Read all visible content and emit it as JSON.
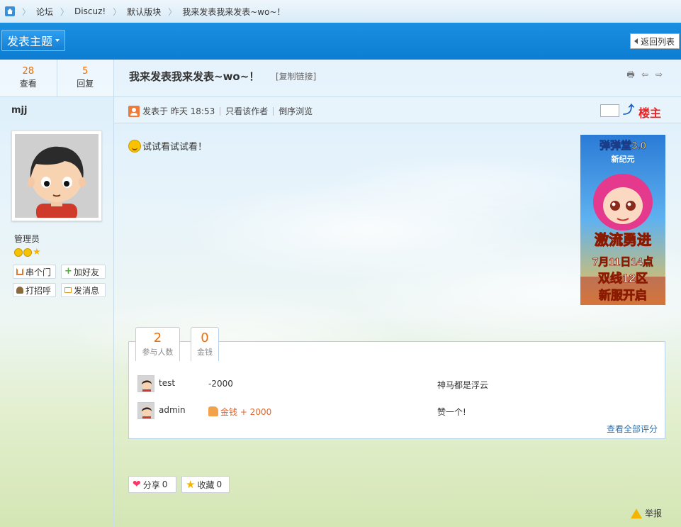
{
  "breadcrumb": {
    "items": [
      "论坛",
      "Discuz!",
      "默认版块",
      "我来发表我来发表~wo~！"
    ]
  },
  "toolbar": {
    "post_label": "发表主题",
    "back_label": "返回列表"
  },
  "stats": {
    "views_count": "28",
    "views_label": "查看",
    "replies_count": "5",
    "replies_label": "回复"
  },
  "author": {
    "username": "mjj",
    "role": "管理员",
    "buttons": [
      "串个门",
      "加好友",
      "打招呼",
      "发消息"
    ]
  },
  "post": {
    "title": "我来发表我来发表~wo~！",
    "copy_link": "[复制链接]",
    "posted_at": "发表于 昨天 18:53",
    "only_author": "只看该作者",
    "reverse_order": "倒序浏览",
    "floor_label": "楼主",
    "body": "试试看试试看！"
  },
  "ad": {
    "title": "弹弹堂3.0",
    "subtitle": "新纪元",
    "line1": "激流勇进",
    "line2": "7月11日14点",
    "line3": "双线12区",
    "line4": "新服开启"
  },
  "rating": {
    "participants_count": "2",
    "participants_label": "参与人数",
    "money_count": "0",
    "money_label": "金钱",
    "rows": [
      {
        "user": "test",
        "score": "-2000",
        "reason": "神马都是浮云"
      },
      {
        "user": "admin",
        "score": "金钱 + 2000",
        "reason": "赞一个!"
      }
    ],
    "view_all": "查看全部评分"
  },
  "actions": {
    "share": "分享",
    "share_count": "0",
    "favorite": "收藏",
    "favorite_count": "0",
    "report": "举报"
  },
  "colors": {
    "header_blue": "#0d7ed3",
    "accent_orange": "#f26c00",
    "floor_red": "#ee2222"
  }
}
